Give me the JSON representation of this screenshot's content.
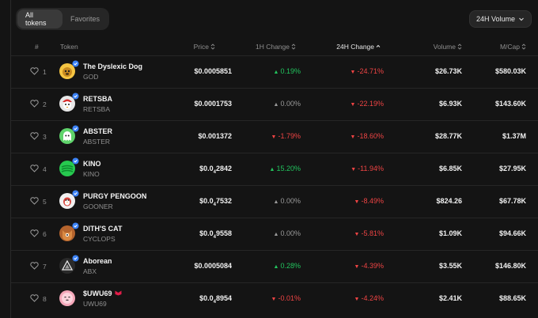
{
  "tabs": [
    {
      "label": "All tokens",
      "active": true
    },
    {
      "label": "Favorites",
      "active": false
    }
  ],
  "timeframe": {
    "label": "24H Volume"
  },
  "columns": {
    "rank": "#",
    "token": "Token",
    "price": "Price",
    "change_1h": "1H Change",
    "change_24h": "24H Change",
    "volume": "Volume",
    "mcap": "M/Cap"
  },
  "colors": {
    "up": "#22c55e",
    "down": "#ef4444",
    "flat": "#9a9a9a",
    "verified": "#3b82f6",
    "warning": "#e11d48"
  },
  "rows": [
    {
      "rank": "1",
      "name": "The Dyslexic Dog",
      "symbol": "GOD",
      "price_main": "$0.0005851",
      "price_sub": "",
      "price_tail": "",
      "ch1_dir": "up",
      "ch1": "0.19%",
      "ch24_dir": "down",
      "ch24": "-24.71%",
      "volume": "$26.73K",
      "mcap": "$580.03K",
      "avatar_icon": "dog-avatar-icon",
      "avatar_color": "#f5c542",
      "verified": true,
      "warning": false
    },
    {
      "rank": "2",
      "name": "RETSBA",
      "symbol": "RETSBA",
      "price_main": "$0.0001753",
      "price_sub": "",
      "price_tail": "",
      "ch1_dir": "flat",
      "ch1": "0.00%",
      "ch24_dir": "down",
      "ch24": "-22.19%",
      "volume": "$6.93K",
      "mcap": "$143.60K",
      "avatar_icon": "red-penguin-avatar-icon",
      "avatar_color": "#e8e8e8",
      "verified": true,
      "warning": false
    },
    {
      "rank": "3",
      "name": "ABSTER",
      "symbol": "ABSTER",
      "price_main": "$0.001372",
      "price_sub": "",
      "price_tail": "",
      "ch1_dir": "down",
      "ch1": "-1.79%",
      "ch24_dir": "down",
      "ch24": "-18.60%",
      "volume": "$28.77K",
      "mcap": "$1.37M",
      "avatar_icon": "green-ghost-avatar-icon",
      "avatar_color": "#5fd36b",
      "verified": true,
      "warning": false
    },
    {
      "rank": "4",
      "name": "KINO",
      "symbol": "KINO",
      "price_main": "$0.0",
      "price_sub": "4",
      "price_tail": "2842",
      "ch1_dir": "up",
      "ch1": "15.20%",
      "ch24_dir": "down",
      "ch24": "-11.94%",
      "volume": "$6.85K",
      "mcap": "$27.95K",
      "avatar_icon": "green-stripes-avatar-icon",
      "avatar_color": "#27c94f",
      "verified": true,
      "warning": false
    },
    {
      "rank": "5",
      "name": "PURGY PENGOON",
      "symbol": "GOONER",
      "price_main": "$0.0",
      "price_sub": "4",
      "price_tail": "7532",
      "ch1_dir": "flat",
      "ch1": "0.00%",
      "ch24_dir": "down",
      "ch24": "-8.49%",
      "volume": "$824.26",
      "mcap": "$67.78K",
      "avatar_icon": "penguin-avatar-icon",
      "avatar_color": "#f0f0f0",
      "verified": true,
      "warning": false
    },
    {
      "rank": "6",
      "name": "DITH'S CAT",
      "symbol": "CYCLOPS",
      "price_main": "$0.0",
      "price_sub": "4",
      "price_tail": "9558",
      "ch1_dir": "flat",
      "ch1": "0.00%",
      "ch24_dir": "down",
      "ch24": "-5.81%",
      "volume": "$1.09K",
      "mcap": "$94.66K",
      "avatar_icon": "cat-avatar-icon",
      "avatar_color": "#b5642d",
      "verified": true,
      "warning": false
    },
    {
      "rank": "7",
      "name": "Aborean",
      "symbol": "ABX",
      "price_main": "$0.0005084",
      "price_sub": "",
      "price_tail": "",
      "ch1_dir": "up",
      "ch1": "0.28%",
      "ch24_dir": "down",
      "ch24": "-4.39%",
      "volume": "$3.55K",
      "mcap": "$146.80K",
      "avatar_icon": "triangle-avatar-icon",
      "avatar_color": "#2a2a2a",
      "verified": true,
      "warning": false
    },
    {
      "rank": "8",
      "name": "$UWU69",
      "symbol": "UWU69",
      "price_main": "$0.0",
      "price_sub": "4",
      "price_tail": "8954",
      "ch1_dir": "down",
      "ch1": "-0.01%",
      "ch24_dir": "down",
      "ch24": "-4.24%",
      "volume": "$2.41K",
      "mcap": "$88.65K",
      "avatar_icon": "pink-face-avatar-icon",
      "avatar_color": "#f4a7b9",
      "verified": false,
      "warning": true
    }
  ]
}
